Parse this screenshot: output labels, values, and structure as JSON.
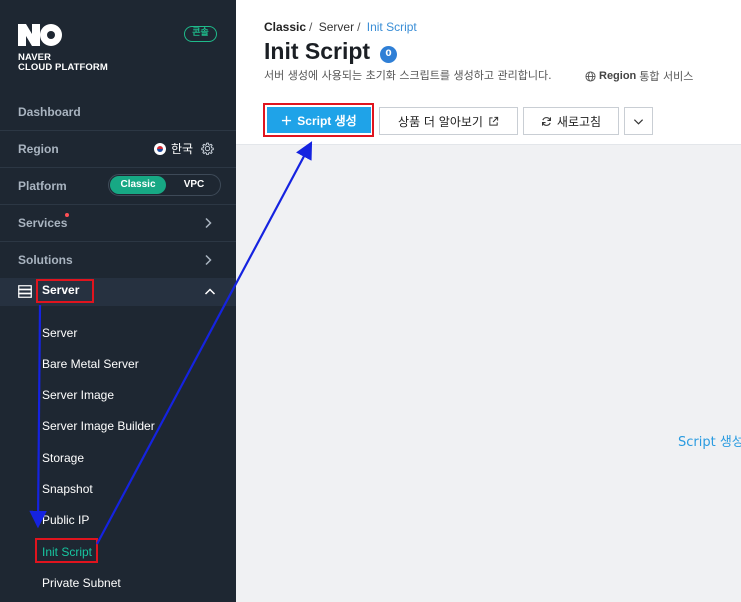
{
  "sidebar": {
    "logo_line1": "NAVER",
    "logo_line2": "CLOUD PLATFORM",
    "console_badge": "콘솔",
    "dashboard": "Dashboard",
    "region_label": "Region",
    "region_value": "한국",
    "platform_label": "Platform",
    "platform_on": "Classic",
    "platform_off": "VPC",
    "services": "Services",
    "solutions": "Solutions",
    "server_section": "Server",
    "sub_items": [
      "Server",
      "Bare Metal Server",
      "Server Image",
      "Server Image Builder",
      "Storage",
      "Snapshot",
      "Public IP",
      "Init Script",
      "Private Subnet"
    ],
    "active_item": "Init Script"
  },
  "main": {
    "breadcrumb": [
      "Classic",
      "Server",
      "Init Script"
    ],
    "title": "Init Script",
    "count": "0",
    "description": "서버 생성에 사용되는 초기화 스크립트를 생성하고 관리합니다.",
    "region_text": "Region",
    "region_suffix": "통합 서비스",
    "create_button": "Script 생성",
    "more_button": "상품 더 알아보기",
    "refresh_button": "새로고침",
    "empty_link": "Script 생성"
  },
  "colors": {
    "sidebar_bg": "#1e2732",
    "accent_green": "#17a884",
    "primary_blue": "#1fa3e8",
    "highlight_red": "#e0141e",
    "arrow_blue": "#1523e0"
  },
  "icons": [
    "naver-logo",
    "gear-icon",
    "chevron-right-icon",
    "chevron-up-icon",
    "server-icon",
    "globe-icon",
    "plus-icon",
    "external-link-icon",
    "refresh-icon",
    "chevron-down-icon",
    "korea-flag-icon"
  ]
}
